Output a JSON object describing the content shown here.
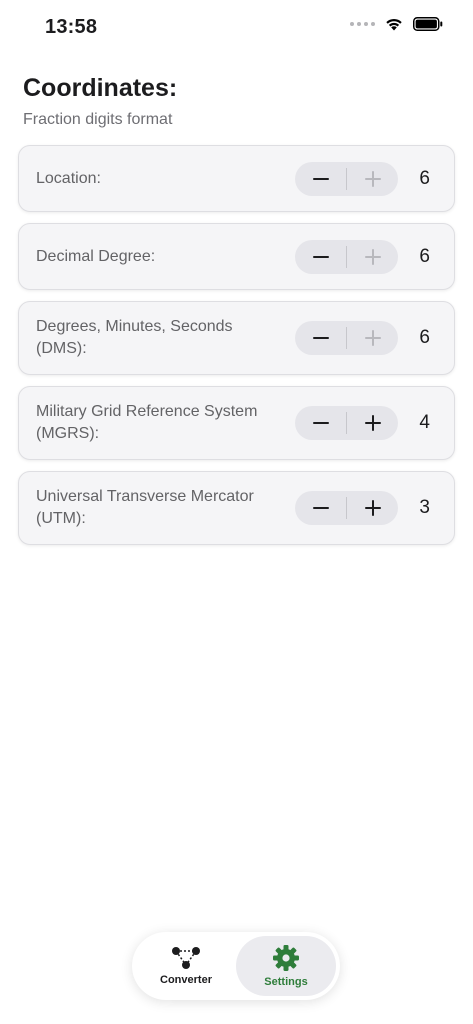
{
  "status_bar": {
    "time": "13:58"
  },
  "header": {
    "title": "Coordinates:",
    "subtitle": "Fraction digits format"
  },
  "rows": [
    {
      "label": "Location:",
      "value": "6",
      "minus_enabled": true,
      "plus_enabled": false
    },
    {
      "label": "Decimal Degree:",
      "value": "6",
      "minus_enabled": true,
      "plus_enabled": false
    },
    {
      "label": "Degrees, Minutes, Seconds (DMS):",
      "value": "6",
      "minus_enabled": true,
      "plus_enabled": false
    },
    {
      "label": "Military Grid Reference System (MGRS):",
      "value": "4",
      "minus_enabled": true,
      "plus_enabled": true
    },
    {
      "label": "Universal Transverse Mercator (UTM):",
      "value": "3",
      "minus_enabled": true,
      "plus_enabled": true
    }
  ],
  "tab_bar": {
    "tabs": [
      {
        "label": "Converter",
        "icon": "converter-graph-icon",
        "active": false
      },
      {
        "label": "Settings",
        "icon": "gear-icon",
        "active": true
      }
    ]
  },
  "colors": {
    "accent": "#2e7d3a",
    "row_background": "#f5f5f7",
    "stepper_background": "#e5e5ea"
  }
}
